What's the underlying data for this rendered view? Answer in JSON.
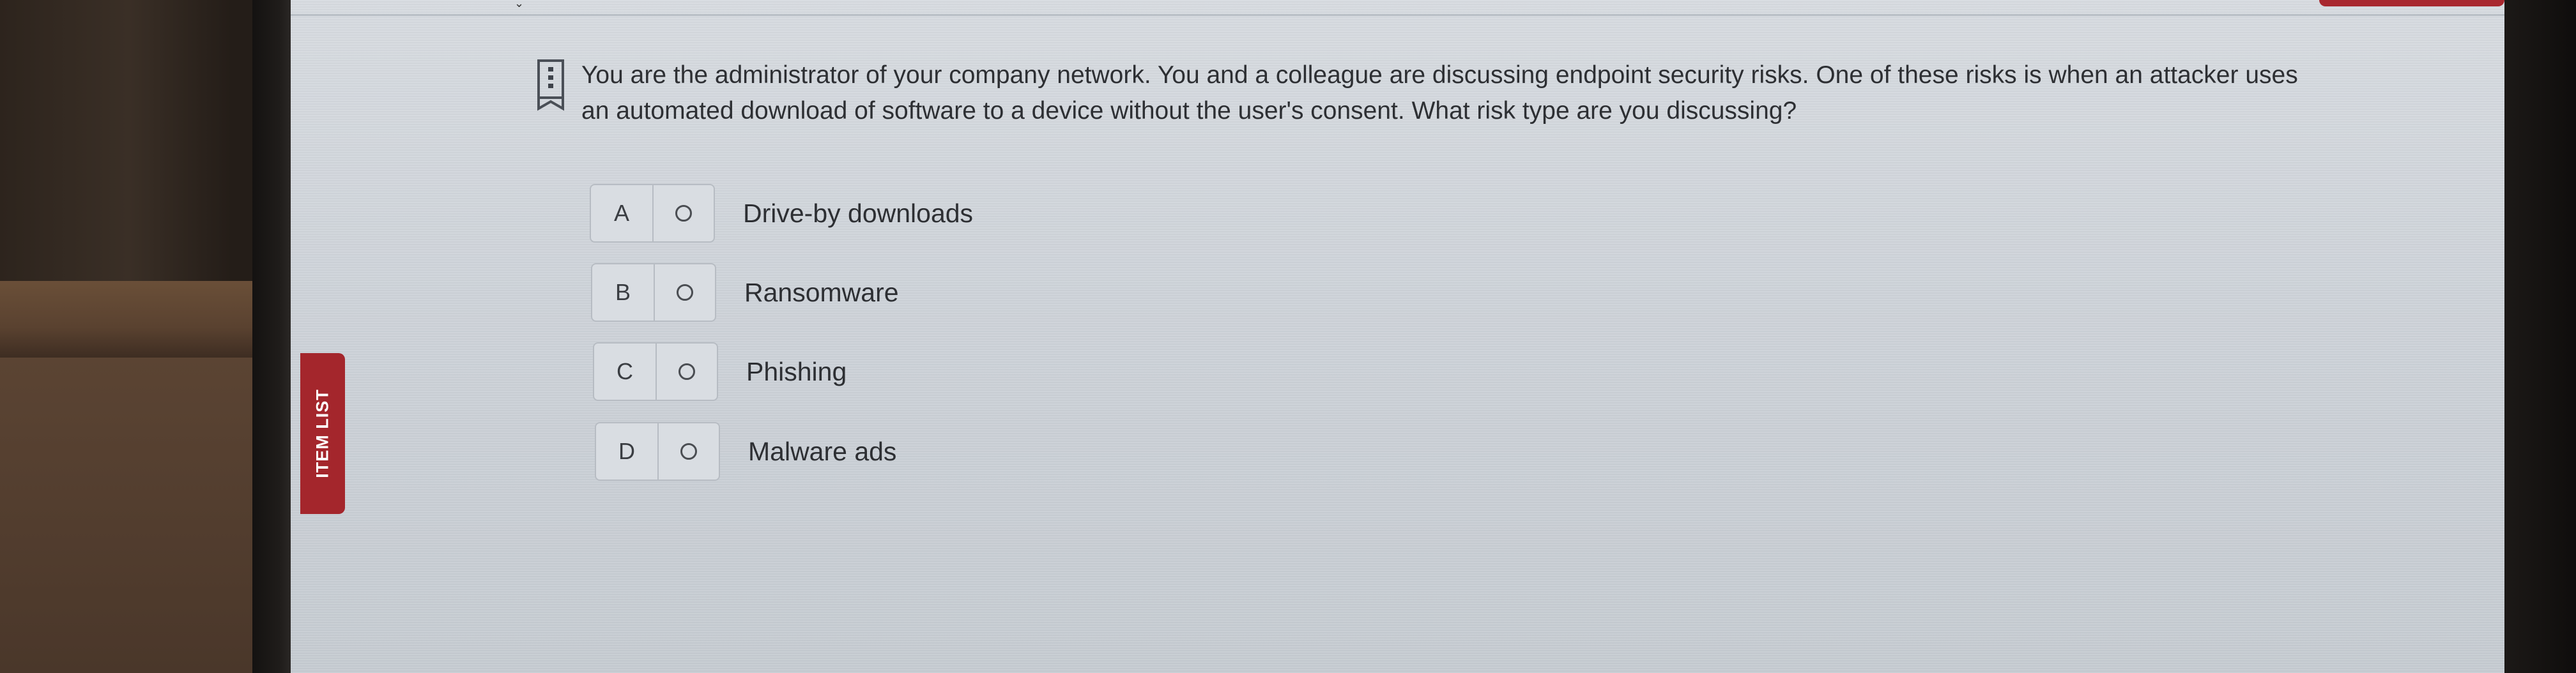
{
  "sidebar": {
    "tab_label": "ITEM LIST"
  },
  "question": {
    "text": "You are the administrator of your company network. You and a colleague are discussing endpoint security risks. One of these risks is when an attacker uses an automated download of software to a device without the user's consent. What risk type are you discussing?"
  },
  "options": [
    {
      "letter": "A",
      "label": "Drive-by downloads"
    },
    {
      "letter": "B",
      "label": "Ransomware"
    },
    {
      "letter": "C",
      "label": "Phishing"
    },
    {
      "letter": "D",
      "label": "Malware ads"
    }
  ],
  "icons": {
    "flag": "bookmark-flag-icon",
    "radio": "radio-button-icon"
  },
  "colors": {
    "accent_red": "#a4262c",
    "screen_bg": "#cdd2d8",
    "text": "#2d2f33"
  }
}
